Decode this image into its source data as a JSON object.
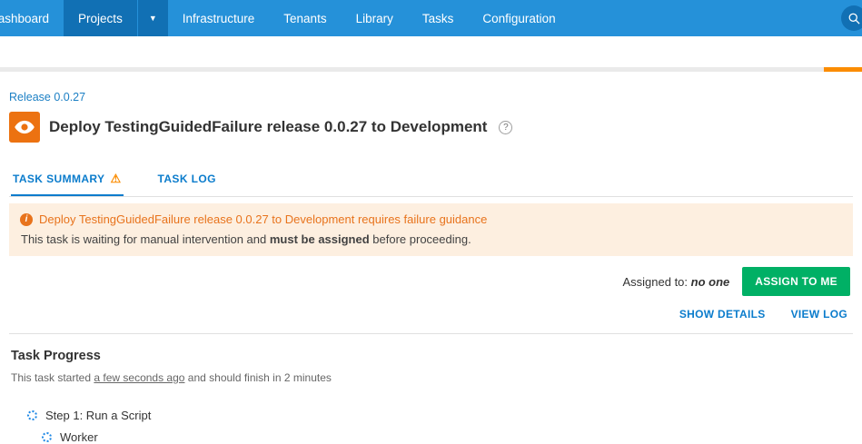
{
  "colors": {
    "nav_blue": "#2591d9",
    "nav_active_blue": "#1170b4",
    "link_blue": "#0b7ccc",
    "accent_orange": "#e8731c",
    "warning_orange": "#fb8c00",
    "alert_background": "#fdefe0",
    "button_green": "#00b065"
  },
  "icons": {
    "caret_glyph": "▼",
    "help_glyph": "?",
    "warning_glyph": "⚠",
    "info_glyph": "i"
  },
  "nav": {
    "dashboard": "Dashboard",
    "projects": "Projects",
    "infrastructure": "Infrastructure",
    "tenants": "Tenants",
    "library": "Library",
    "tasks": "Tasks",
    "configuration": "Configuration"
  },
  "breadcrumb": {
    "release": "Release 0.0.27"
  },
  "header": {
    "title": "Deploy TestingGuidedFailure release 0.0.27 to Development"
  },
  "tabs": {
    "summary": "TASK SUMMARY",
    "log": "TASK LOG"
  },
  "alert": {
    "title": "Deploy TestingGuidedFailure release 0.0.27 to Development requires failure guidance",
    "body_prefix": "This task is waiting for manual intervention and ",
    "body_bold": "must be assigned",
    "body_suffix": " before proceeding."
  },
  "assignment": {
    "label": "Assigned to:",
    "value": "no one",
    "assign_button": "ASSIGN TO ME",
    "show_details": "SHOW DETAILS",
    "view_log": "VIEW LOG"
  },
  "progress": {
    "heading": "Task Progress",
    "started_prefix": "This task started ",
    "started_time": "a few seconds ago",
    "started_mid": " and should finish in ",
    "finish_time": "2 minutes",
    "step1": "Step 1: Run a Script",
    "step1_child": "Worker"
  }
}
